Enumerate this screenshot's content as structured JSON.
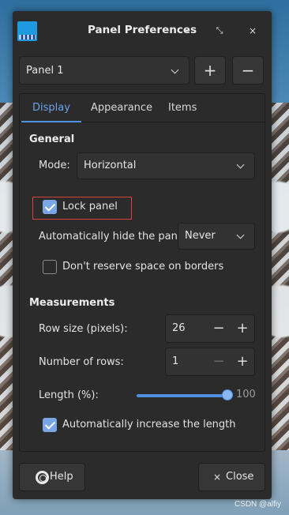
{
  "window": {
    "title": "Panel Preferences",
    "controls": {
      "minimize": "–",
      "maximize": "⤡",
      "close": "×"
    }
  },
  "panel_selector": {
    "value": "Panel 1",
    "add_label": "+",
    "remove_label": "−"
  },
  "tabs": [
    {
      "label": "Display",
      "active": true
    },
    {
      "label": "Appearance",
      "active": false
    },
    {
      "label": "Items",
      "active": false
    }
  ],
  "general": {
    "title": "General",
    "mode_label": "Mode:",
    "mode_value": "Horizontal",
    "lock_panel_label": "Lock panel",
    "lock_panel_checked": true,
    "autohide_label": "Automatically hide the panel:",
    "autohide_value": "Never",
    "reserve_space_label": "Don't reserve space on borders",
    "reserve_space_checked": false
  },
  "measurements": {
    "title": "Measurements",
    "row_size_label": "Row size (pixels):",
    "row_size_value": "26",
    "rows_label": "Number of rows:",
    "rows_value": "1",
    "length_label": "Length (%):",
    "length_value": "100",
    "auto_length_label": "Automatically increase the length",
    "auto_length_checked": true
  },
  "footer": {
    "help_label": "Help",
    "close_label": "Close",
    "close_icon": "×"
  },
  "watermark": "CSDN @alfiy",
  "colors": {
    "accent": "#4f90e2",
    "highlight_border": "#d9413c",
    "window_bg": "#2b2b2b"
  }
}
